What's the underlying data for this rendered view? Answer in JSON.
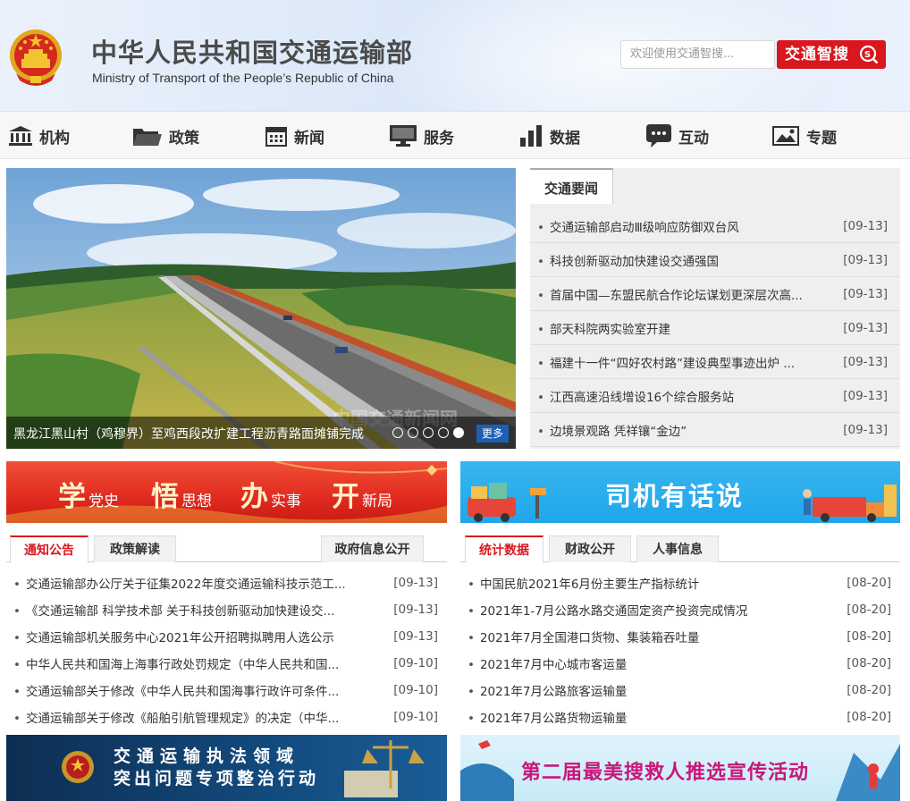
{
  "header": {
    "title_cn": "中华人民共和国交通运输部",
    "title_en": "Ministry of Transport of the People’s Republic of China",
    "search_placeholder": "欢迎使用交通智搜...",
    "search_button": "交通智搜"
  },
  "nav": [
    {
      "label": "机构",
      "icon": "building-icon"
    },
    {
      "label": "政策",
      "icon": "folder-icon"
    },
    {
      "label": "新闻",
      "icon": "calendar-icon"
    },
    {
      "label": "服务",
      "icon": "monitor-icon"
    },
    {
      "label": "数据",
      "icon": "bar-chart-icon"
    },
    {
      "label": "互动",
      "icon": "chat-bubble-icon"
    },
    {
      "label": "专题",
      "icon": "picture-icon"
    }
  ],
  "banner": {
    "caption": "黑龙江黑山村（鸡穆界）至鸡西段改扩建工程沥青路面摊铺完成",
    "more": "更多",
    "watermark": "中国交通新闻网",
    "slides_total": 5,
    "slide_active": 5
  },
  "news": {
    "tab": "交通要闻",
    "items": [
      {
        "title": "交通运输部启动Ⅲ级响应防御双台风",
        "date": "[09-13]"
      },
      {
        "title": "科技创新驱动加快建设交通强国",
        "date": "[09-13]"
      },
      {
        "title": "首届中国—东盟民航合作论坛谋划更深层次高...",
        "date": "[09-13]"
      },
      {
        "title": "部天科院两实验室开建",
        "date": "[09-13]"
      },
      {
        "title": "福建十一件“四好农村路”建设典型事迹出炉 ...",
        "date": "[09-13]"
      },
      {
        "title": "江西高速沿线增设16个综合服务站",
        "date": "[09-13]"
      },
      {
        "title": "边境景观路 凭祥镶“金边”",
        "date": "[09-13]"
      }
    ]
  },
  "promo_left": {
    "segments": [
      {
        "big": "学",
        "small": "党史"
      },
      {
        "big": "悟",
        "small": "思想"
      },
      {
        "big": "办",
        "small": "实事"
      },
      {
        "big": "开",
        "small": "新局"
      }
    ]
  },
  "promo_right": {
    "text": "司机有话说"
  },
  "panel_left": {
    "tabs": [
      "通知公告",
      "政策解读",
      "政府信息公开"
    ],
    "items": [
      {
        "title": "交通运输部办公厅关于征集2022年度交通运输科技示范工...",
        "date": "[09-13]"
      },
      {
        "title": "《交通运输部 科学技术部 关于科技创新驱动加快建设交...",
        "date": "[09-13]"
      },
      {
        "title": "交通运输部机关服务中心2021年公开招聘拟聘用人选公示",
        "date": "[09-13]"
      },
      {
        "title": "中华人民共和国海上海事行政处罚规定（中华人民共和国...",
        "date": "[09-10]"
      },
      {
        "title": "交通运输部关于修改《中华人民共和国海事行政许可条件...",
        "date": "[09-10]"
      },
      {
        "title": "交通运输部关于修改《船舶引航管理规定》的决定（中华...",
        "date": "[09-10]"
      }
    ]
  },
  "panel_right": {
    "tabs": [
      "统计数据",
      "财政公开",
      "人事信息"
    ],
    "items": [
      {
        "title": "中国民航2021年6月份主要生产指标统计",
        "date": "[08-20]"
      },
      {
        "title": "2021年1-7月公路水路交通固定资产投资完成情况",
        "date": "[08-20]"
      },
      {
        "title": "2021年7月全国港口货物、集装箱吞吐量",
        "date": "[08-20]"
      },
      {
        "title": "2021年7月中心城市客运量",
        "date": "[08-20]"
      },
      {
        "title": "2021年7月公路旅客运输量",
        "date": "[08-20]"
      },
      {
        "title": "2021年7月公路货物运输量",
        "date": "[08-20]"
      }
    ]
  },
  "promo_bottom_left": {
    "line1": "交通运输执法领域",
    "line2": "突出问题专项整治行动"
  },
  "promo_bottom_right": {
    "text": "第二届最美搜救人推选宣传活动"
  },
  "colors": {
    "brand_red": "#d9171f",
    "more_blue": "#1e5fb3"
  }
}
